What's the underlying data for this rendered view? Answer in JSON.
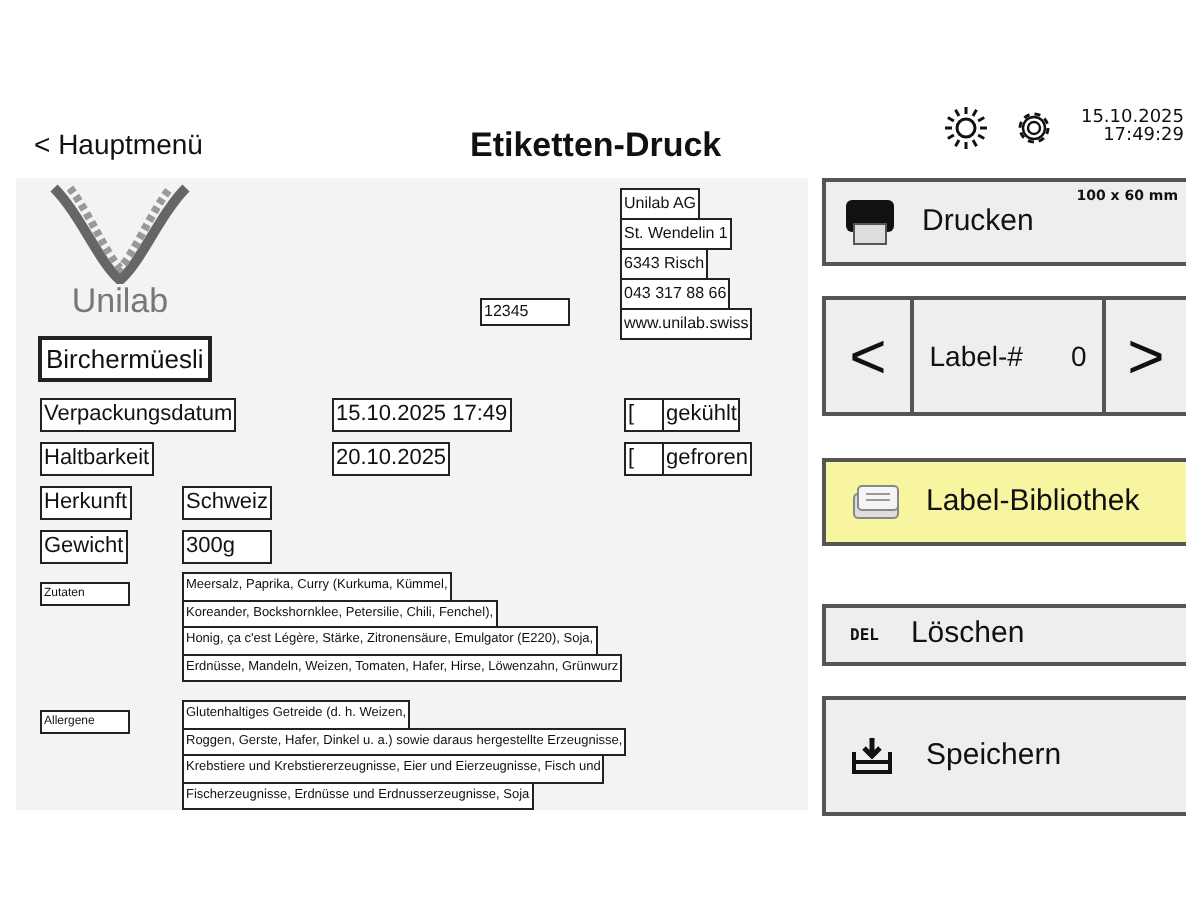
{
  "header": {
    "back": "< Hauptmenü",
    "title": "Etiketten-Druck",
    "date": "15.10.2025",
    "time": "17:49:29"
  },
  "label": {
    "logo_text": "Unilab",
    "number": "12345",
    "address": [
      "Unilab AG",
      "St. Wendelin 1",
      "6343 Risch",
      "043 317 88 66",
      "www.unilab.swiss"
    ],
    "product": "Birchermüesli",
    "date_rows": [
      {
        "label": "Verpackungsdatum",
        "value": "15.10.2025  17:49",
        "check": "[",
        "check_label": "gekühlt"
      },
      {
        "label": "Haltbarkeit",
        "value": "20.10.2025",
        "check": "[",
        "check_label": "gefroren"
      }
    ],
    "info_rows": [
      {
        "label": "Herkunft",
        "value": "Schweiz"
      },
      {
        "label": "Gewicht",
        "value": "300g"
      }
    ],
    "text_blocks": [
      {
        "label": "Zutaten",
        "lines": [
          "Meersalz, Paprika, Curry (Kurkuma, Kümmel,",
          "Koreander, Bockshornklee, Petersilie, Chili, Fenchel),",
          "Honig, ça c'est Légère, Stärke, Zitronensäure, Emulgator (E220), Soja,",
          "Erdnüsse, Mandeln, Weizen, Tomaten, Hafer, Hirse, Löwenzahn, Grünwurz"
        ]
      },
      {
        "label": "Allergene",
        "lines": [
          "Glutenhaltiges Getreide (d. h. Weizen,",
          "Roggen, Gerste, Hafer, Dinkel u. a.) sowie daraus hergestellte Erzeugnisse,",
          "Krebstiere und Krebstiererzeugnisse, Eier und Eierzeugnisse, Fisch und",
          "Fischerzeugnisse, Erdnüsse und Erdnusserzeugnisse, Soja"
        ]
      }
    ]
  },
  "actions": [
    {
      "kind": "print",
      "label": "Drucken",
      "size": "100 x 60 mm"
    },
    {
      "kind": "nav",
      "prev": "<",
      "label": "Label-#",
      "value": "0",
      "next": ">"
    },
    {
      "kind": "library",
      "label": "Label-Bibliothek",
      "highlighted": true
    },
    {
      "kind": "delete",
      "key": "DEL",
      "label": "Löschen"
    },
    {
      "kind": "save",
      "label": "Speichern"
    }
  ]
}
